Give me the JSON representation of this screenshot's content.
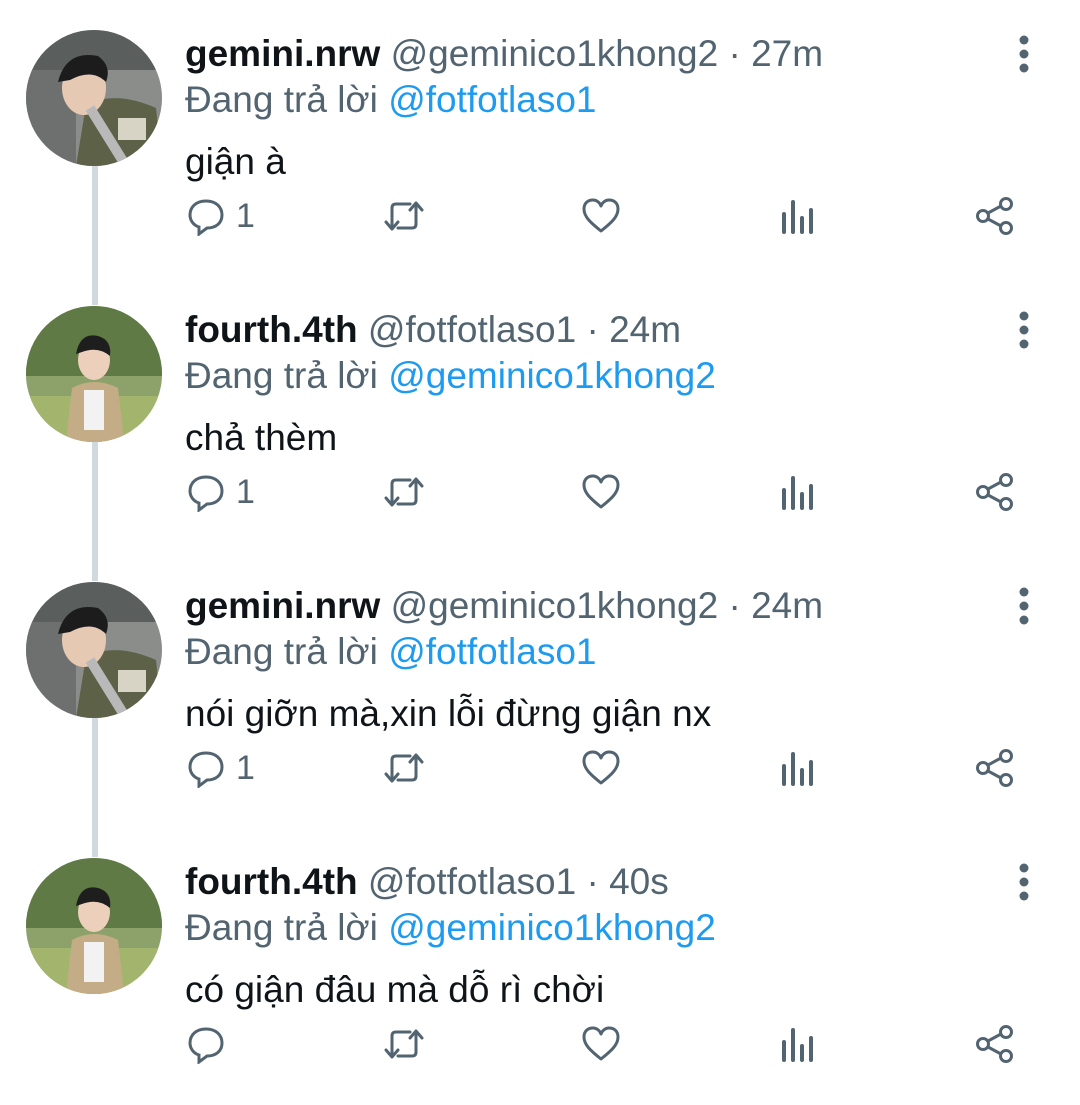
{
  "reply_prefix": "Đang trả lời",
  "tweets": [
    {
      "display_name": "gemini.nrw",
      "handle": "@geminico1khong2",
      "time": "· 27m",
      "replying_to": "@fotfotlaso1",
      "text": "giận à",
      "reply_count": "1",
      "avatar": "avatar-gemini"
    },
    {
      "display_name": "fourth.4th",
      "handle": "@fotfotlaso1",
      "time": "· 24m",
      "replying_to": "@geminico1khong2",
      "text": "chả thèm",
      "reply_count": "1",
      "avatar": "avatar-fourth"
    },
    {
      "display_name": "gemini.nrw",
      "handle": "@geminico1khong2",
      "time": "· 24m",
      "replying_to": "@fotfotlaso1",
      "text": "nói giỡn mà,xin lỗi đừng giận nx",
      "reply_count": "1",
      "avatar": "avatar-gemini"
    },
    {
      "display_name": "fourth.4th",
      "handle": "@fotfotlaso1",
      "time": "· 40s",
      "replying_to": "@geminico1khong2",
      "text": "có giận đâu mà dỗ rì chời",
      "reply_count": "",
      "avatar": "avatar-fourth"
    }
  ],
  "icons": {
    "reply": "reply-icon",
    "retweet": "retweet-icon",
    "like": "like-icon",
    "views": "views-icon",
    "share": "share-icon",
    "more": "more-options-icon"
  },
  "colors": {
    "name": "#0f1419",
    "secondary": "#536471",
    "mention": "#1d9bf0",
    "thread_line": "#cfd9de"
  }
}
